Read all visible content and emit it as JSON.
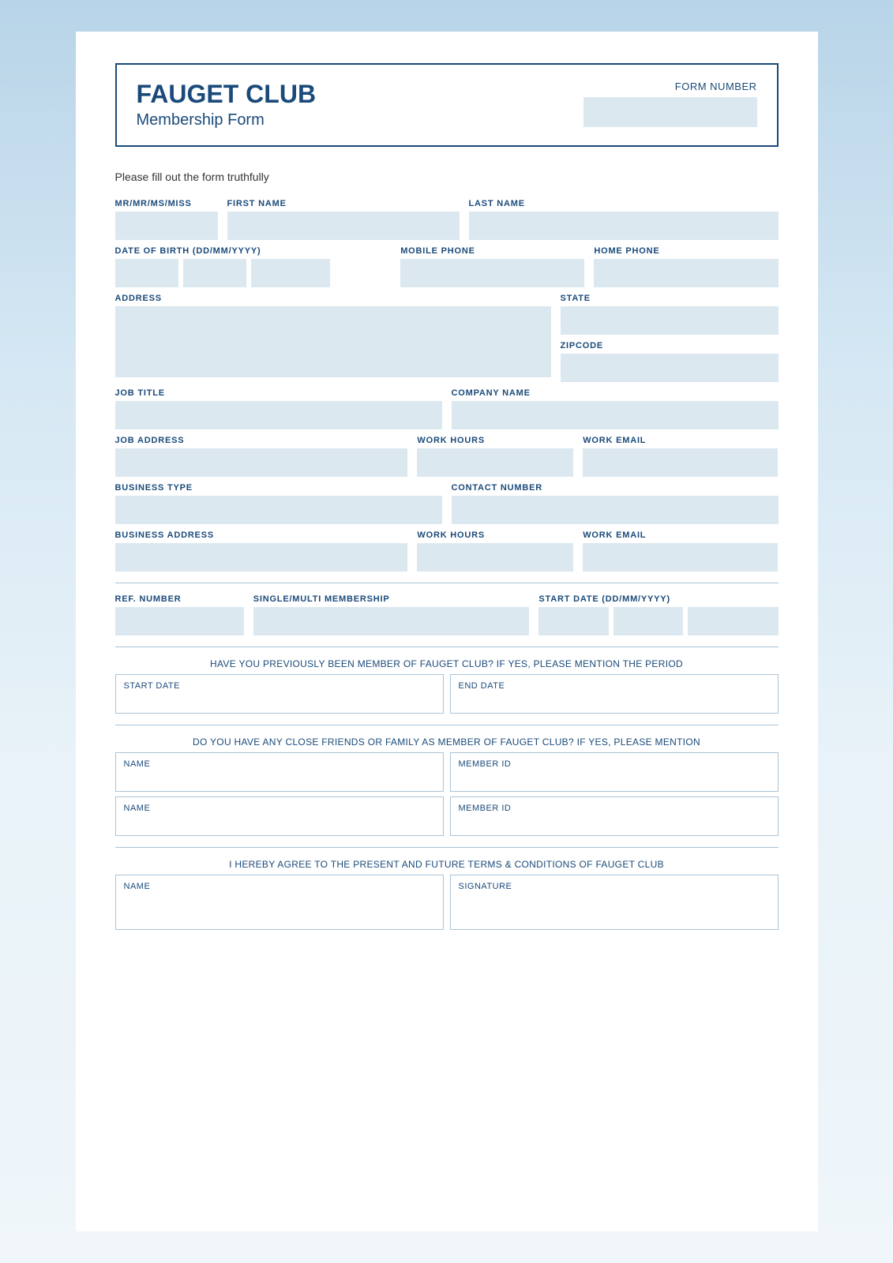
{
  "header": {
    "club_name": "FAUGET CLUB",
    "membership_form": "Membership Form",
    "form_number_label": "FORM NUMBER"
  },
  "instructions": "Please fill out the form truthfully",
  "fields": {
    "title_label": "MR/MR/MS/MISS",
    "first_name_label": "FIRST NAME",
    "last_name_label": "LAST NAME",
    "dob_label": "DATE OF BIRTH (DD/MM/YYYY)",
    "mobile_phone_label": "MOBILE PHONE",
    "home_phone_label": "HOME PHONE",
    "address_label": "ADDRESS",
    "state_label": "STATE",
    "zipcode_label": "ZIPCODE",
    "job_title_label": "JOB TITLE",
    "company_name_label": "COMPANY NAME",
    "job_address_label": "JOB ADDRESS",
    "work_hours_label": "WORK HOURS",
    "work_email_label": "WORK EMAIL",
    "business_type_label": "BUSINESS TYPE",
    "contact_number_label": "CONTACT NUMBER",
    "business_address_label": "BUSINESS ADDRESS",
    "work_hours2_label": "WORK HOURS",
    "work_email2_label": "WORK EMAIL",
    "ref_number_label": "REF. NUMBER",
    "single_multi_label": "SINGLE/MULTI MEMBERSHIP",
    "start_date_label": "START DATE (DD/MM/YYYY)"
  },
  "previous_member": {
    "question": "HAVE YOU PREVIOUSLY BEEN MEMBER OF FAUGET CLUB? IF YES, PLEASE MENTION THE PERIOD",
    "start_date_label": "START DATE",
    "end_date_label": "END DATE"
  },
  "friends_family": {
    "question": "DO YOU HAVE ANY CLOSE FRIENDS OR FAMILY AS MEMBER OF FAUGET CLUB? IF YES, PLEASE MENTION",
    "name_label": "NAME",
    "member_id_label": "MEMBER ID"
  },
  "agreement": {
    "text": "I HEREBY AGREE TO THE PRESENT AND FUTURE TERMS & CONDITIONS OF FAUGET CLUB",
    "name_label": "NAME",
    "signature_label": "SIGNATURE"
  }
}
